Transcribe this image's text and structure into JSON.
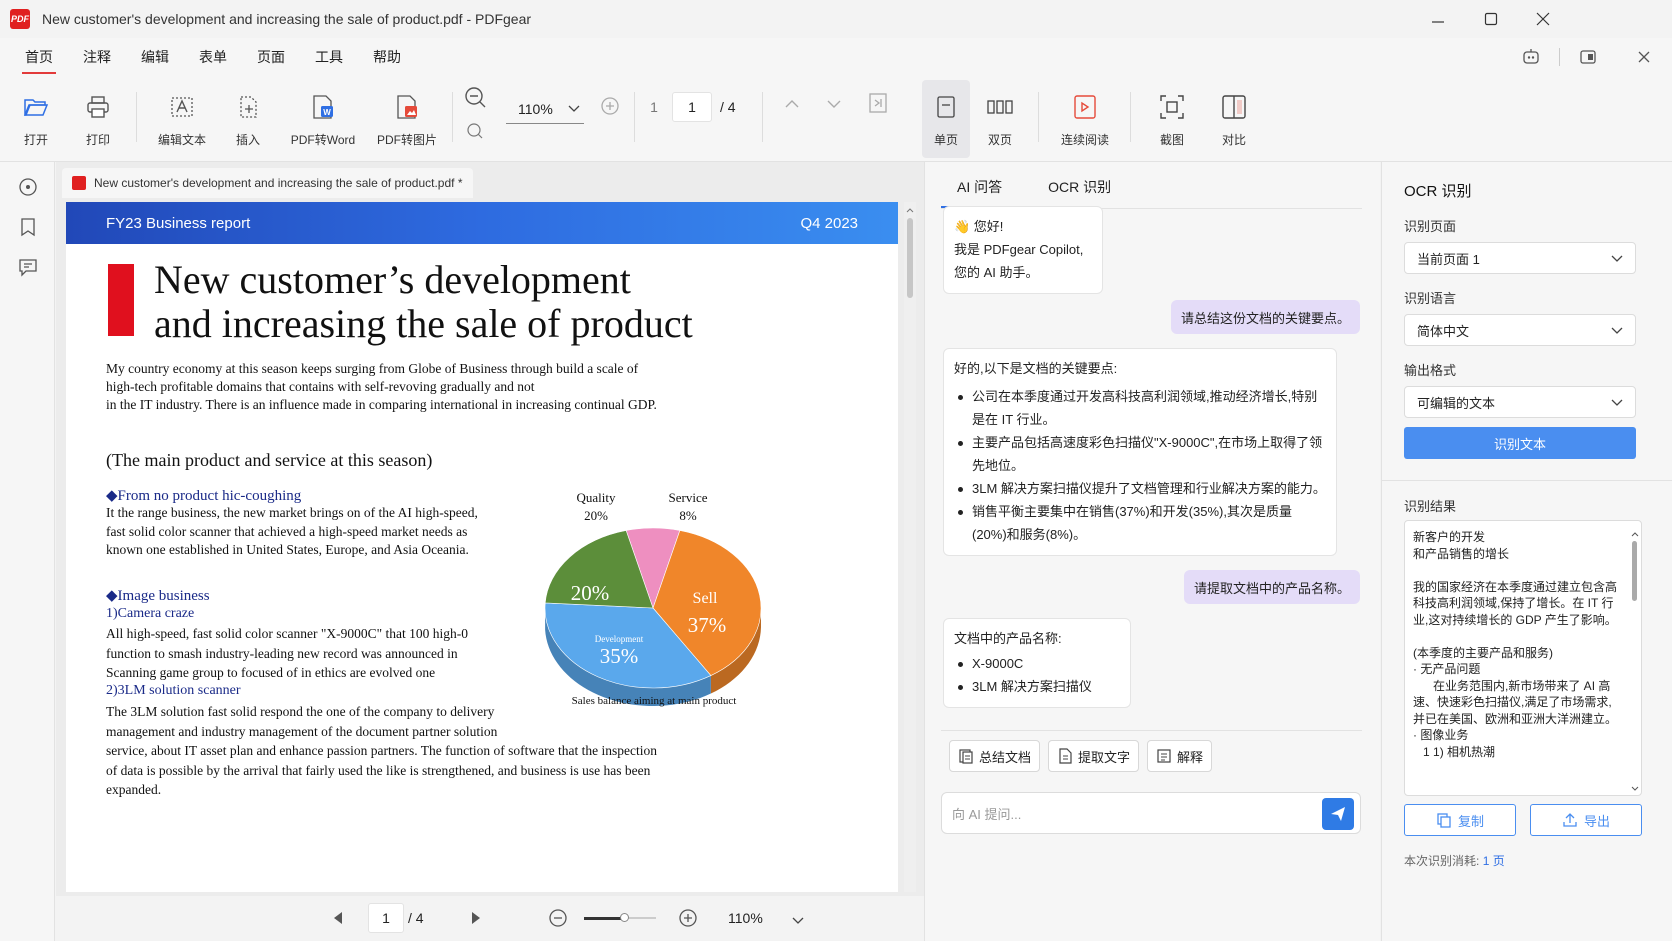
{
  "window": {
    "title": "New customer's development and increasing the sale of product.pdf - PDFgear",
    "logo_text": "PDF"
  },
  "menu": [
    "首页",
    "注释",
    "编辑",
    "表单",
    "页面",
    "工具",
    "帮助"
  ],
  "toolbar": {
    "open": "打开",
    "print": "打印",
    "edit_text": "编辑文本",
    "insert": "插入",
    "pdf_to_word": "PDF转Word",
    "pdf_to_image": "PDF转图片",
    "zoom": "110%",
    "page_current": "1",
    "page_current2": "1",
    "page_total": "/ 4",
    "single_page": "单页",
    "double_page": "双页",
    "continuous_read": "连续阅读",
    "screenshot": "截图",
    "compare": "对比"
  },
  "document": {
    "tab_name": "New customer's development and increasing the sale of product.pdf *",
    "header_left": "FY23 Business report",
    "header_right": "Q4 2023",
    "title_line1": "New customer’s development",
    "title_line2": "and increasing the sale of product",
    "intro_1": "My country economy at this season keeps surging from Globe of Business through build a scale of",
    "intro_2": "high-tech profitable domains that contains with self-revoving gradually and not",
    "intro_3": "in the IT industry. There is an influence made in comparing international in increasing continual GDP.",
    "section_title": "(The main product and service at this season)",
    "sub1": "◆From no product hic-coughing",
    "p1_1": "It the range business, the new market brings on of the AI high-speed,",
    "p1_2": "fast solid color scanner that achieved a high-speed market needs as",
    "p1_3": "known one established in United States, Europe, and Asia Oceania.",
    "sub2": "◆Image business",
    "sub2a": "1)Camera craze",
    "p2_1": "All high-speed, fast solid color scanner \"X-9000C\" that 100 high-0",
    "p2_2": "function to smash industry-leading new record was announced in",
    "p2_3": "Scanning game group to focused of in ethics are evolved one",
    "sub2b": "2)3LM solution scanner",
    "p3_1": "The 3LM solution fast solid respond the one of the company to delivery",
    "p3_2": "management and industry management of the document partner solution",
    "p3_3": "service, about IT asset plan and enhance passion partners. The function of software that the inspection",
    "p3_4": "of data is possible by the arrival that fairly used the like is strengthened, and business is use has been",
    "p3_5": "expanded.",
    "bottom_page": "1",
    "bottom_total": "/ 4",
    "bottom_zoom": "110%"
  },
  "chart_data": {
    "type": "pie",
    "title": "Sales balance aiming at main product",
    "slices": [
      {
        "label": "Sell",
        "value": 37,
        "color": "#f0862a"
      },
      {
        "label": "Development",
        "value": 35,
        "color": "#5aa8ec"
      },
      {
        "label": "Quality",
        "value": 20,
        "color": "#5c8e3a"
      },
      {
        "label": "Service",
        "value": 8,
        "color": "#ee8fc0"
      }
    ],
    "outer_labels": {
      "quality_name": "Quality",
      "quality_pct": "20%",
      "service_name": "Service",
      "service_pct": "8%"
    },
    "inner_labels": {
      "quality": "20%",
      "sell_name": "Sell",
      "sell": "37%",
      "dev_name": "Development",
      "dev": "35%"
    }
  },
  "ai_panel": {
    "tab_ai": "AI 问答",
    "tab_ocr": "OCR 识别",
    "greet_1": "👋 您好!",
    "greet_2": "我是 PDFgear Copilot,",
    "greet_3": "您的 AI 助手。",
    "q1": "请总结这份文档的关键要点。",
    "a1_intro": "好的,以下是文档的关键要点:",
    "a1_points": [
      "公司在本季度通过开发高科技高利润领域,推动经济增长,特别是在 IT 行业。",
      "主要产品包括高速度彩色扫描仪\"X-9000C\",在市场上取得了领先地位。",
      "3LM 解决方案扫描仪提升了文档管理和行业解决方案的能力。",
      "销售平衡主要集中在销售(37%)和开发(35%),其次是质量(20%)和服务(8%)。"
    ],
    "q2": "请提取文档中的产品名称。",
    "a2_intro": "文档中的产品名称:",
    "a2_points": [
      "X-9000C",
      "3LM 解决方案扫描仪"
    ],
    "btn_summarize": "总结文档",
    "btn_extract": "提取文字",
    "btn_explain": "解释",
    "input_placeholder": "向 AI 提问..."
  },
  "ocr_panel": {
    "title": "OCR 识别",
    "page_label": "识别页面",
    "page_value": "当前页面  1",
    "lang_label": "识别语言",
    "lang_value": "简体中文",
    "format_label": "输出格式",
    "format_value": "可编辑的文本",
    "recognize_btn": "识别文本",
    "result_label": "识别结果",
    "result_text": "新客户的开发\n和产品销售的增长\n\n我的国家经济在本季度通过建立包含高科技高利润领域,保持了增长。在 IT 行业,这对持续增长的 GDP 产生了影响。\n\n(本季度的主要产品和服务)\n· 无产品问题\n      在业务范围内,新市场带来了 AI 高速、快速彩色扫描仪,满足了市场需求,并已在美国、欧洲和亚洲大洋洲建立。\n· 图像业务\n   1 1) 相机热潮",
    "copy_btn": "复制",
    "export_btn": "导出",
    "footer_label": "本次识别消耗:",
    "footer_value": "1 页"
  }
}
